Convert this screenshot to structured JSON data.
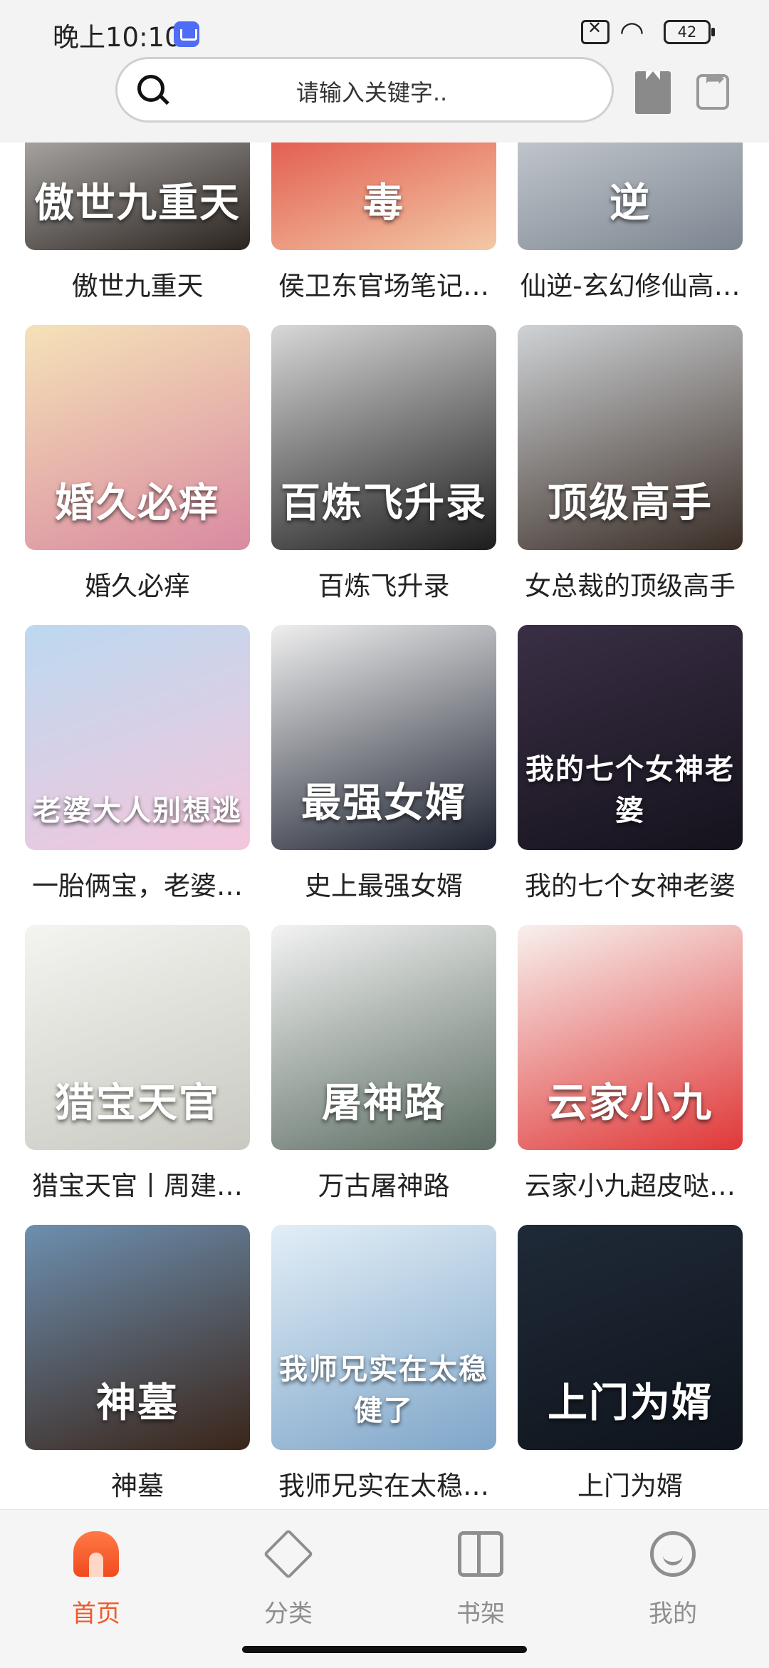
{
  "status_bar": {
    "time": "晚上10:10",
    "battery": "42"
  },
  "search": {
    "placeholder": "请输入关键字.."
  },
  "books": [
    {
      "title": "傲世九重天",
      "cover_text": "傲世九重天",
      "colors": [
        "#f2f0ee",
        "#2a2420"
      ]
    },
    {
      "title": "侯卫东官场笔记…",
      "cover_text": "毒",
      "colors": [
        "#d91e1e",
        "#f3c9a6"
      ]
    },
    {
      "title": "仙逆-玄幻修仙高…",
      "cover_text": "逆",
      "colors": [
        "#e9ecef",
        "#7c8590"
      ]
    },
    {
      "title": "婚久必痒",
      "cover_text": "婚久必痒",
      "colors": [
        "#f5e2b8",
        "#d98aa0"
      ]
    },
    {
      "title": "百炼飞升录",
      "cover_text": "百炼飞升录",
      "colors": [
        "#d8d8d8",
        "#1c1c1c"
      ]
    },
    {
      "title": "女总裁的顶级高手",
      "cover_text": "顶级高手",
      "colors": [
        "#cfd3d6",
        "#3a2d26"
      ]
    },
    {
      "title": "一胎俩宝，老婆…",
      "cover_text": "老婆大人别想逃",
      "colors": [
        "#bcd9f0",
        "#f4c6dc"
      ]
    },
    {
      "title": "史上最强女婿",
      "cover_text": "最强女婿",
      "colors": [
        "#efefef",
        "#1d2230"
      ]
    },
    {
      "title": "我的七个女神老婆",
      "cover_text": "我的七个女神老婆",
      "colors": [
        "#3a2f45",
        "#15121c"
      ]
    },
    {
      "title": "猎宝天官丨周建…",
      "cover_text": "猎宝天官",
      "colors": [
        "#f4f4f0",
        "#c9c9c2"
      ]
    },
    {
      "title": "万古屠神路",
      "cover_text": "屠神路",
      "colors": [
        "#f3f3f3",
        "#5c6d63"
      ]
    },
    {
      "title": "云家小九超皮哒…",
      "cover_text": "云家小九",
      "colors": [
        "#f7f1ee",
        "#e03838"
      ]
    },
    {
      "title": "神墓",
      "cover_text": "神墓",
      "colors": [
        "#6d8fb0",
        "#3a2519"
      ]
    },
    {
      "title": "我师兄实在太稳…",
      "cover_text": "我师兄实在太稳健了",
      "colors": [
        "#e2eef7",
        "#7fa6c9"
      ]
    },
    {
      "title": "上门为婿",
      "cover_text": "上门为婿",
      "colors": [
        "#1f2a38",
        "#0f141c"
      ]
    }
  ],
  "partial_row_colors": [
    "#2b3344",
    "#3a4a34",
    "#c9d6e6"
  ],
  "nav": [
    {
      "label": "首页",
      "icon": "home-icon",
      "active": true
    },
    {
      "label": "分类",
      "icon": "cube-icon",
      "active": false
    },
    {
      "label": "书架",
      "icon": "shelf-icon",
      "active": false
    },
    {
      "label": "我的",
      "icon": "smile-icon",
      "active": false
    }
  ],
  "accent_color": "#f05a2b"
}
